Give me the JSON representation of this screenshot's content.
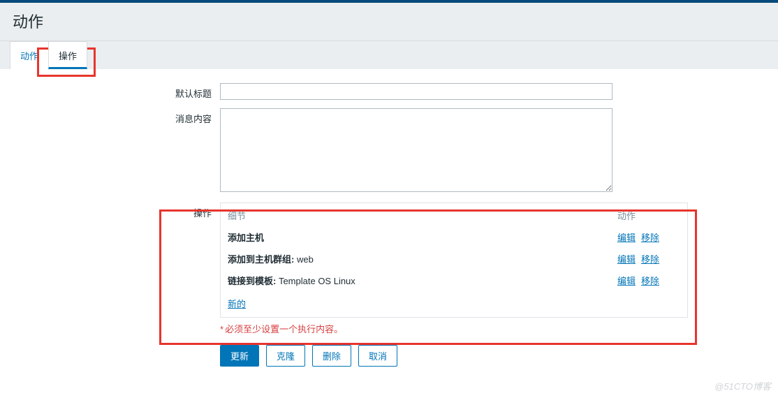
{
  "page": {
    "title": "动作"
  },
  "tabs": {
    "action": "动作",
    "operations": "操作"
  },
  "form": {
    "default_subject_label": "默认标题",
    "default_subject_value": "",
    "default_message_label": "消息内容",
    "default_message_value": "",
    "operations_label": "操作"
  },
  "ops_table": {
    "header_detail": "细节",
    "header_action": "动作",
    "rows": [
      {
        "bold": "添加主机",
        "suffix": ""
      },
      {
        "bold": "添加到主机群组:",
        "suffix": " web"
      },
      {
        "bold": "链接到模板:",
        "suffix": " Template OS Linux"
      }
    ],
    "edit_label": "编辑",
    "remove_label": "移除",
    "new_label": "新的"
  },
  "validation": {
    "text": "必须至少设置一个执行内容。"
  },
  "buttons": {
    "update": "更新",
    "clone": "克隆",
    "delete": "删除",
    "cancel": "取消"
  },
  "watermark": "@51CTO博客"
}
